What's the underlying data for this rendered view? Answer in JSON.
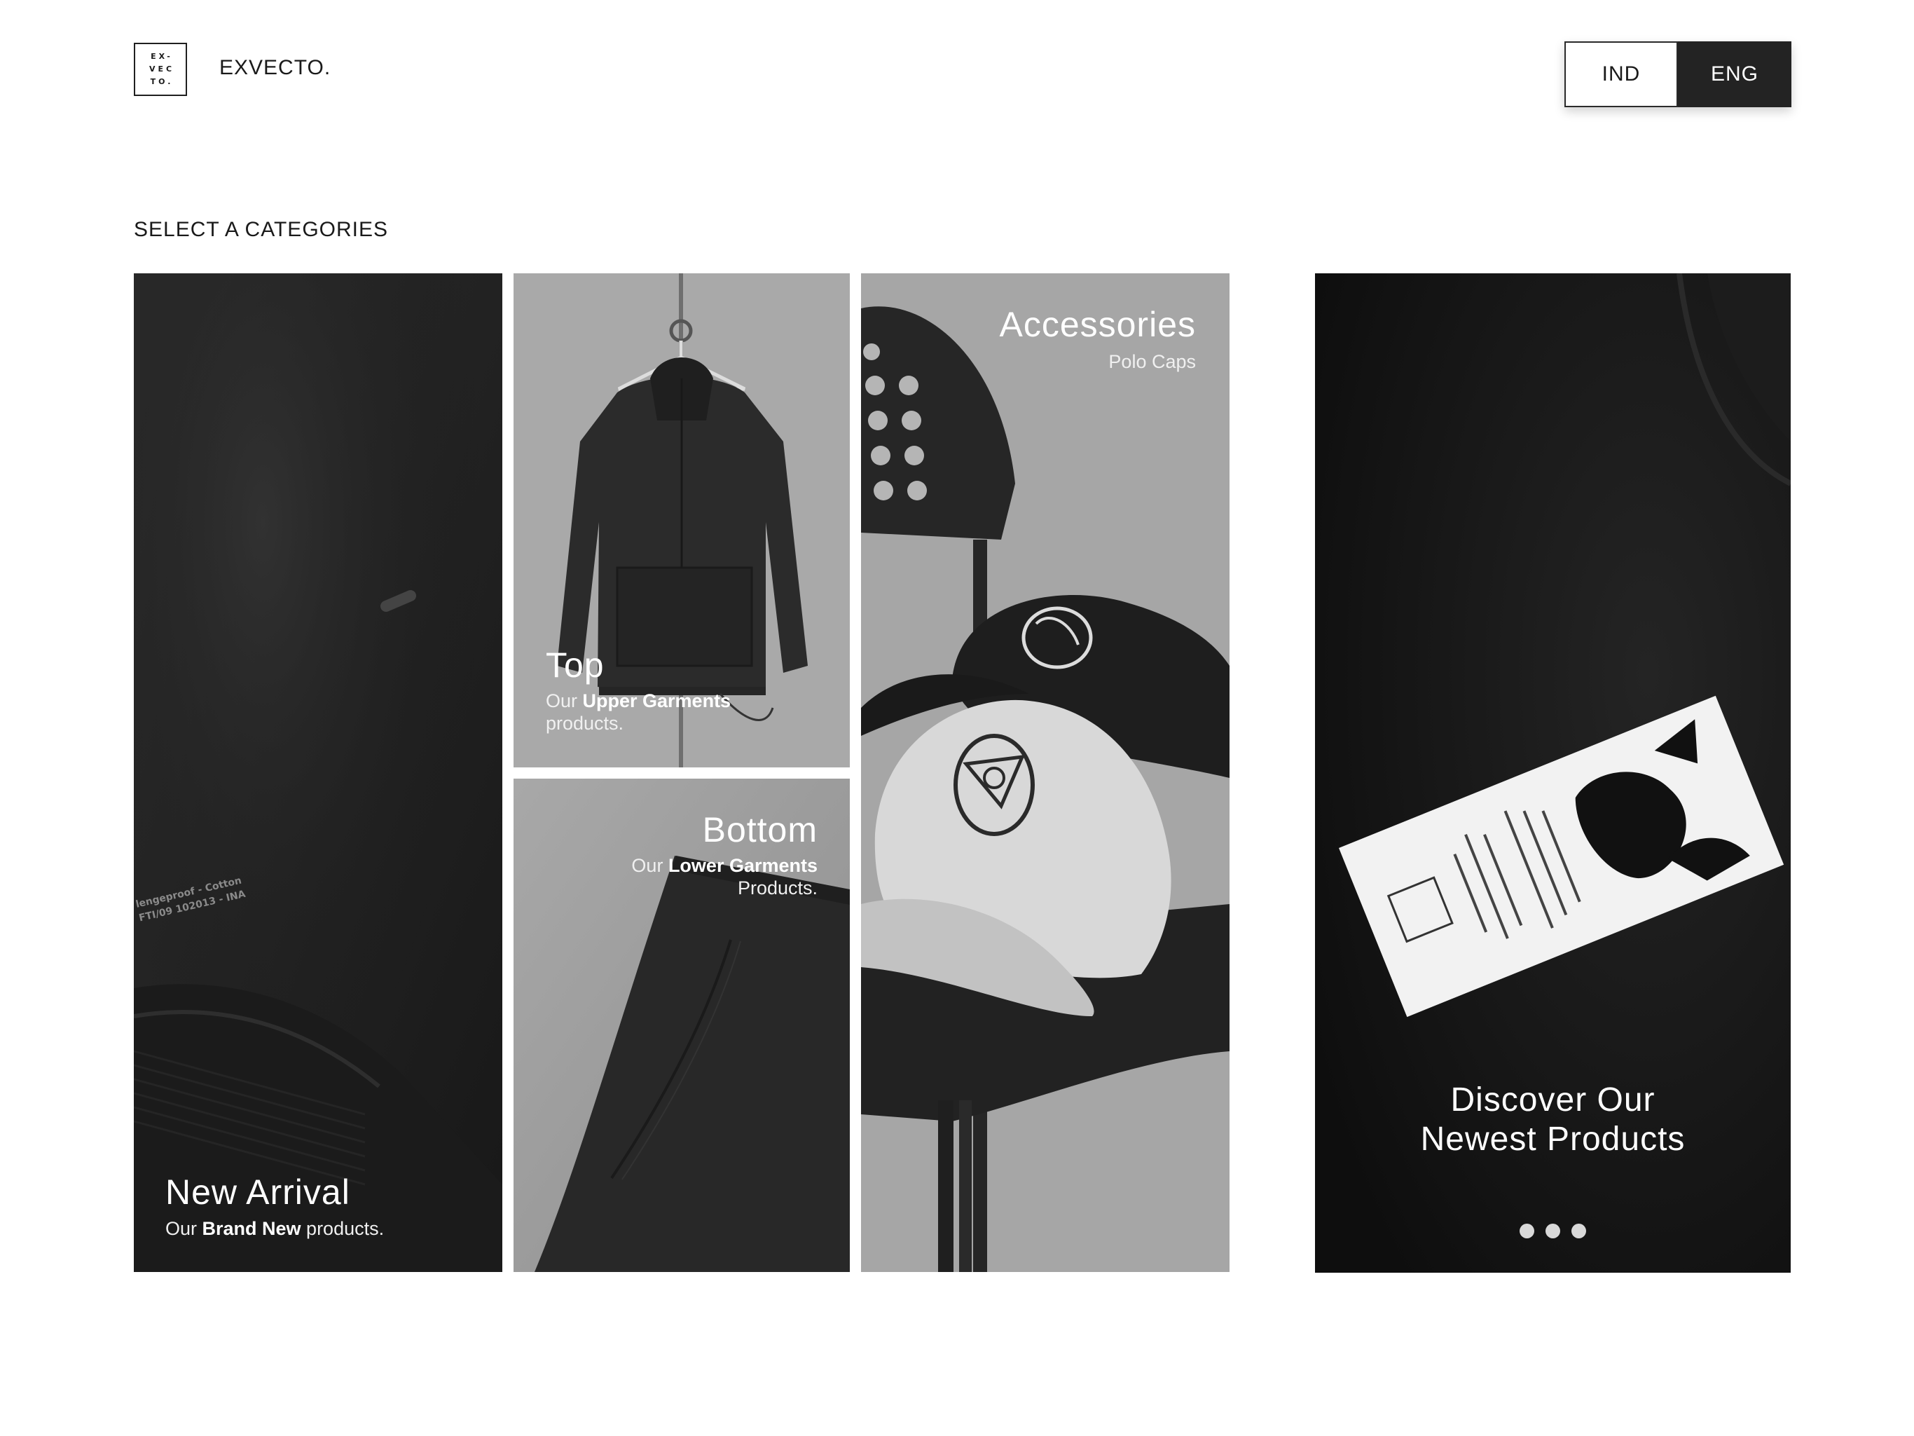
{
  "header": {
    "logo_lines": [
      "EX-",
      "VEC",
      "TO."
    ],
    "brand": "EXVECTO.",
    "languages": [
      {
        "label": "IND",
        "active": false
      },
      {
        "label": "ENG",
        "active": true
      }
    ]
  },
  "section_title": "SELECT A CATEGORIES",
  "cards": {
    "new_arrival": {
      "title": "New Arrival",
      "sub_prefix": "Our ",
      "sub_bold": "Brand New",
      "sub_suffix": " products.",
      "sleeve_print": [
        "lengeproof - Cotton",
        "FTI/09 102013 - INA"
      ]
    },
    "top": {
      "title": "Top",
      "sub_prefix": "Our ",
      "sub_bold": "Upper Garments",
      "sub_suffix": "products."
    },
    "bottom": {
      "title": "Bottom",
      "sub_prefix": "Our ",
      "sub_bold": "Lower Garments",
      "sub_suffix": "Products."
    },
    "accessories": {
      "title": "Accessories",
      "sub": "Polo Caps"
    },
    "hero": {
      "title_line1": "Discover Our",
      "title_line2": "Newest Products",
      "slide_count": 3
    }
  },
  "colors": {
    "dark": "#232323",
    "light": "#ffffff",
    "dot": "#d9d9d9"
  }
}
